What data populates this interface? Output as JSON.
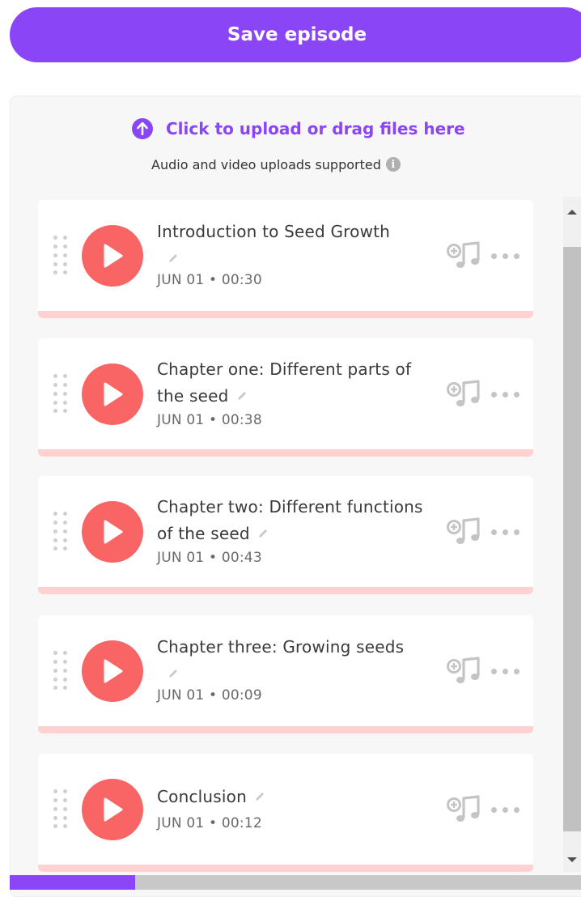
{
  "header": {
    "save_label": "Save episode"
  },
  "upload": {
    "title": "Click to upload or drag files here",
    "subtitle": "Audio and video uploads supported",
    "info_icon": "i"
  },
  "episodes": [
    {
      "title": "Introduction to Seed Growth",
      "date": "JUN 01 • 00:30"
    },
    {
      "title": "Chapter one: Different parts of the seed",
      "date": "JUN 01 • 00:38"
    },
    {
      "title": "Chapter two: Different functions of the seed",
      "date": "JUN 01 • 00:43"
    },
    {
      "title": "Chapter three: Growing seeds",
      "date": "JUN 01 • 00:09"
    },
    {
      "title": "Conclusion",
      "date": "JUN 01 • 00:12"
    }
  ],
  "icons": {
    "upload": "arrow-up-circle-icon",
    "play": "play-icon",
    "edit": "pencil-icon",
    "drag": "drag-handle-icon",
    "add_music": "add-music-icon",
    "more": "more-options-icon"
  },
  "upload_progress": 0.22,
  "colors": {
    "accent": "#8a45f7",
    "play": "#f96464",
    "card_bar": "#ffd1d1"
  }
}
